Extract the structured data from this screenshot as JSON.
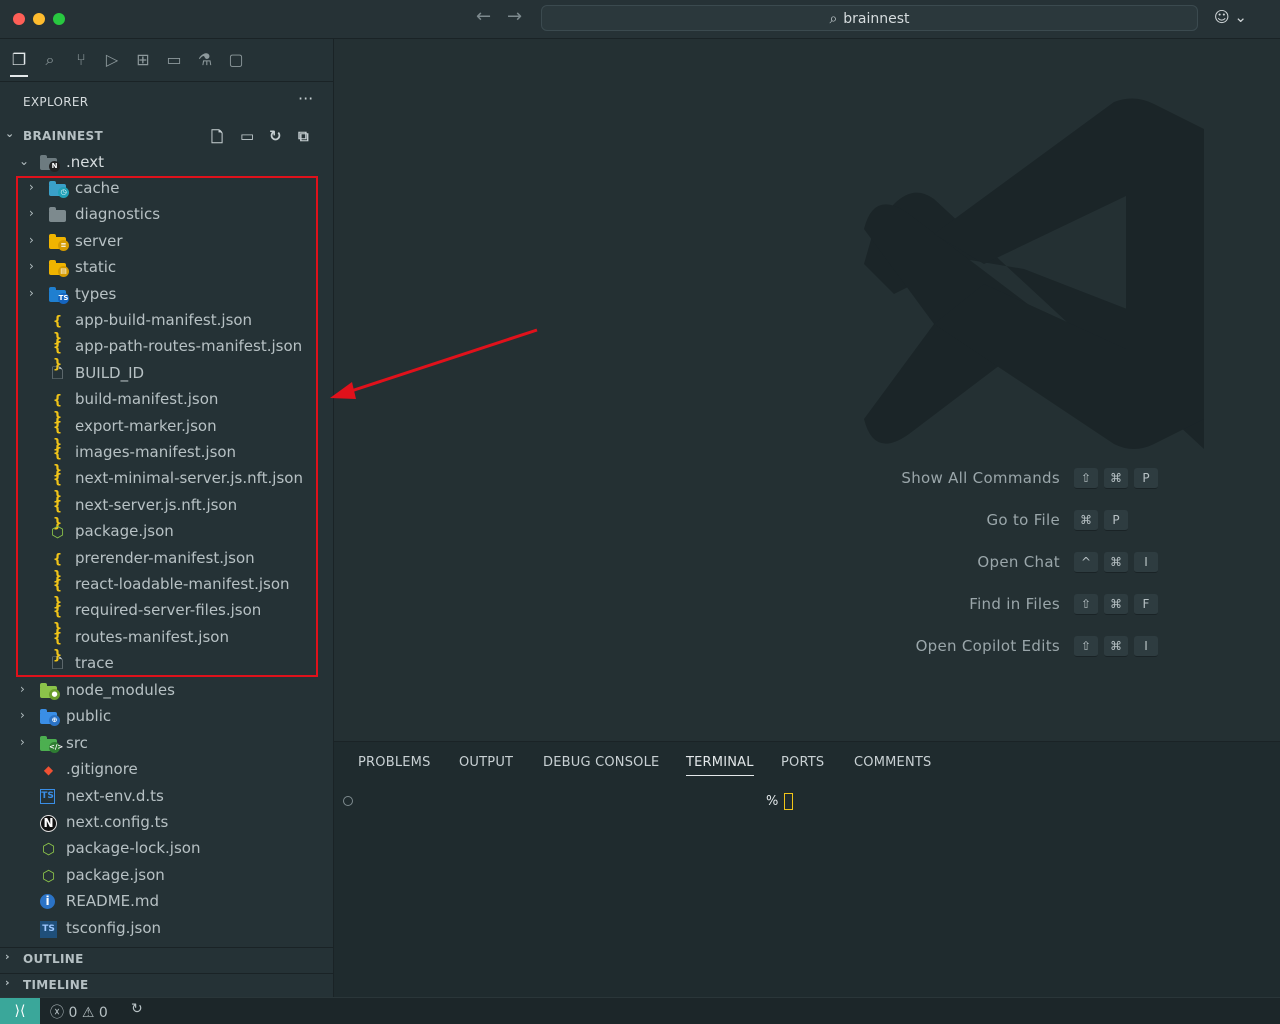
{
  "window": {
    "title": "brainnest",
    "search_icon": "search-icon",
    "back_icon": "arrow-left-icon",
    "forward_icon": "arrow-right-icon",
    "copilot_icon": "copilot-icon",
    "copilot_chevron": "chevron-down-icon"
  },
  "activity_bar": [
    "files-icon",
    "search-icon",
    "source-control-icon",
    "run-debug-icon",
    "extensions-icon",
    "folder-icon",
    "test-icon",
    "chat-icon"
  ],
  "explorer": {
    "title": "EXPLORER",
    "more": "···",
    "root": "BRAINNEST",
    "tools": [
      "new-file-icon",
      "new-folder-icon",
      "refresh-icon",
      "collapse-all-icon"
    ],
    "next_folder": ".next",
    "next_children": [
      {
        "name": "cache",
        "kind": "folder",
        "chev": true
      },
      {
        "name": "diagnostics",
        "kind": "folder",
        "chev": true
      },
      {
        "name": "server",
        "kind": "folder",
        "chev": true
      },
      {
        "name": "static",
        "kind": "folder",
        "chev": true
      },
      {
        "name": "types",
        "kind": "folder",
        "chev": true
      },
      {
        "name": "app-build-manifest.json",
        "kind": "json"
      },
      {
        "name": "app-path-routes-manifest.json",
        "kind": "json"
      },
      {
        "name": "BUILD_ID",
        "kind": "file"
      },
      {
        "name": "build-manifest.json",
        "kind": "json"
      },
      {
        "name": "export-marker.json",
        "kind": "json"
      },
      {
        "name": "images-manifest.json",
        "kind": "json"
      },
      {
        "name": "next-minimal-server.js.nft.json",
        "kind": "json"
      },
      {
        "name": "next-server.js.nft.json",
        "kind": "json"
      },
      {
        "name": "package.json",
        "kind": "nodejs"
      },
      {
        "name": "prerender-manifest.json",
        "kind": "json"
      },
      {
        "name": "react-loadable-manifest.json",
        "kind": "json"
      },
      {
        "name": "required-server-files.json",
        "kind": "json"
      },
      {
        "name": "routes-manifest.json",
        "kind": "json"
      },
      {
        "name": "trace",
        "kind": "file"
      }
    ],
    "root_children": [
      {
        "name": "node_modules",
        "kind": "folder",
        "chev": true
      },
      {
        "name": "public",
        "kind": "folder",
        "chev": true
      },
      {
        "name": "src",
        "kind": "folder",
        "chev": true
      },
      {
        "name": ".gitignore",
        "kind": "git"
      },
      {
        "name": "next-env.d.ts",
        "kind": "ts"
      },
      {
        "name": "next.config.ts",
        "kind": "next"
      },
      {
        "name": "package-lock.json",
        "kind": "nodejs"
      },
      {
        "name": "package.json",
        "kind": "nodejs"
      },
      {
        "name": "README.md",
        "kind": "info"
      },
      {
        "name": "tsconfig.json",
        "kind": "tsconfig"
      }
    ],
    "outline": "OUTLINE",
    "timeline": "TIMELINE"
  },
  "welcome": {
    "commands": [
      {
        "label": "Show All Commands",
        "keys": [
          "⇧",
          "⌘",
          "P"
        ]
      },
      {
        "label": "Go to File",
        "keys": [
          "⌘",
          "P"
        ]
      },
      {
        "label": "Open Chat",
        "keys": [
          "^",
          "⌘",
          "I"
        ]
      },
      {
        "label": "Find in Files",
        "keys": [
          "⇧",
          "⌘",
          "F"
        ]
      },
      {
        "label": "Open Copilot Edits",
        "keys": [
          "⇧",
          "⌘",
          "I"
        ]
      }
    ]
  },
  "panel": {
    "tabs": [
      "PROBLEMS",
      "OUTPUT",
      "DEBUG CONSOLE",
      "TERMINAL",
      "PORTS",
      "COMMENTS"
    ],
    "active_tab": "TERMINAL",
    "prompt": "%"
  },
  "status": {
    "remote_icon": "remote-icon",
    "errors": "0",
    "warnings": "0",
    "sync_icon": "sync-icon"
  },
  "colors": {
    "highlight": "#e0111b",
    "json": "#f0c419",
    "accent": "#3aa79a"
  }
}
